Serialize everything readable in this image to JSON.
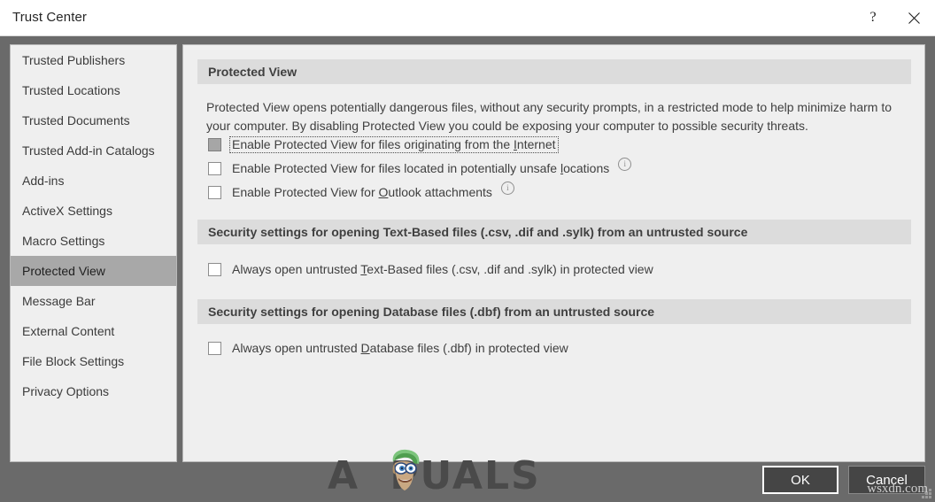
{
  "window": {
    "title": "Trust Center",
    "help_icon": "question-mark-icon",
    "close_icon": "close-x-icon"
  },
  "sidebar": {
    "items": [
      {
        "label": "Trusted Publishers",
        "selected": false
      },
      {
        "label": "Trusted Locations",
        "selected": false
      },
      {
        "label": "Trusted Documents",
        "selected": false
      },
      {
        "label": "Trusted Add-in Catalogs",
        "selected": false
      },
      {
        "label": "Add-ins",
        "selected": false
      },
      {
        "label": "ActiveX Settings",
        "selected": false
      },
      {
        "label": "Macro Settings",
        "selected": false
      },
      {
        "label": "Protected View",
        "selected": true
      },
      {
        "label": "Message Bar",
        "selected": false
      },
      {
        "label": "External Content",
        "selected": false
      },
      {
        "label": "File Block Settings",
        "selected": false
      },
      {
        "label": "Privacy Options",
        "selected": false
      }
    ]
  },
  "main": {
    "section1": {
      "header": "Protected View",
      "description": "Protected View opens potentially dangerous files, without any security prompts, in a restricted mode to help minimize harm to your computer. By disabling Protected View you could be exposing your computer to possible security threats.",
      "checkboxes": [
        {
          "pre": "Enable Protected View for files originating from the ",
          "accel": "I",
          "post": "nternet",
          "checked": false,
          "pressed": true,
          "focused": true,
          "info": false
        },
        {
          "pre": "Enable Protected View for files located in potentially unsafe ",
          "accel": "l",
          "post": "ocations",
          "checked": false,
          "pressed": false,
          "focused": false,
          "info": true
        },
        {
          "pre": "Enable Protected View for ",
          "accel": "O",
          "post": "utlook attachments",
          "checked": false,
          "pressed": false,
          "focused": false,
          "info": true
        }
      ]
    },
    "section2": {
      "header": "Security settings for opening Text-Based files (.csv, .dif and .sylk) from an untrusted source",
      "checkboxes": [
        {
          "pre": "Always open untrusted ",
          "accel": "T",
          "post": "ext-Based files (.csv, .dif and .sylk) in protected view",
          "checked": false,
          "pressed": false,
          "focused": false,
          "info": false
        }
      ]
    },
    "section3": {
      "header": "Security settings for opening Database files (.dbf) from an untrusted source",
      "checkboxes": [
        {
          "pre": "Always open untrusted ",
          "accel": "D",
          "post": "atabase files (.dbf) in protected view",
          "checked": false,
          "pressed": false,
          "focused": false,
          "info": false
        }
      ]
    }
  },
  "footer": {
    "ok_label": "OK",
    "cancel_label": "Cancel"
  },
  "watermarks": {
    "brand": "A",
    "brand_rest": "PUALS",
    "site": "wsxdn.com"
  },
  "colors": {
    "dialog_frame": "#6a6a6a",
    "panel_bg": "#efefef",
    "section_header_bg": "#dcdcdc",
    "selected_item_bg": "#a8a8a8",
    "button_bg": "#454545",
    "text": "#3f3f3f"
  }
}
